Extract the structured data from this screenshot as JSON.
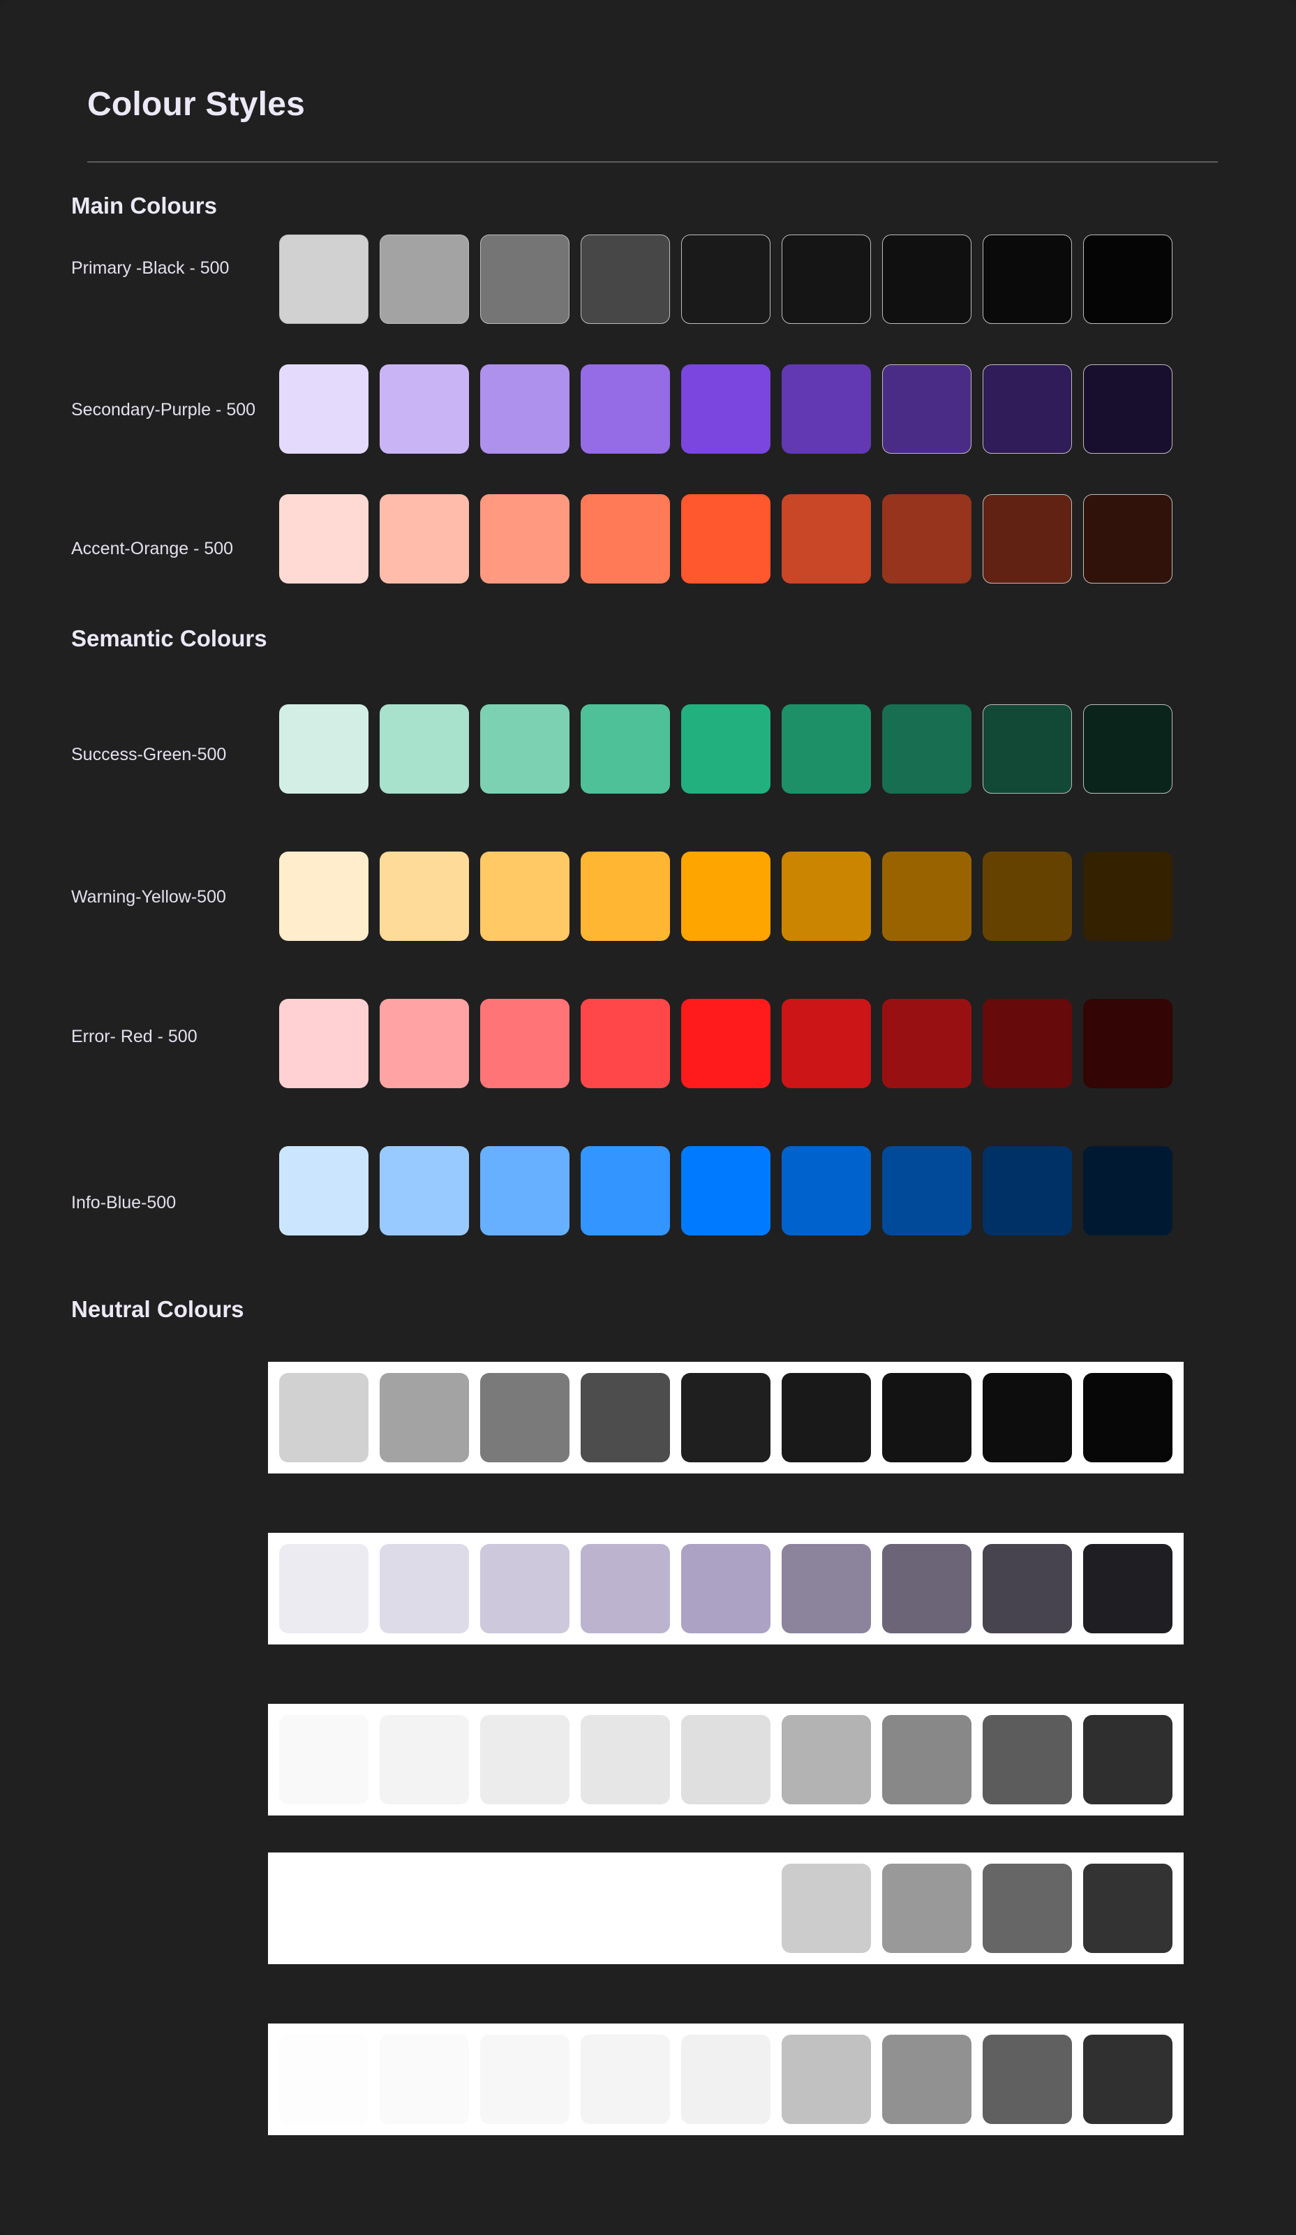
{
  "page": {
    "title": "Colour Styles"
  },
  "sections": {
    "main": "Main Colours",
    "semantic": "Semantic Colours",
    "neutral": "Neutral Colours"
  },
  "palettes": {
    "primary": {
      "label": "Primary -Black - 500",
      "swatches": [
        "#d1d1d1",
        "#a3a3a3",
        "#757575",
        "#474747",
        "#1a1a1a",
        "#151515",
        "#101010",
        "#0a0a0a",
        "#050505"
      ]
    },
    "secondary": {
      "label": "Secondary-Purple - 500",
      "swatches": [
        "#e4dafb",
        "#c9b5f5",
        "#ae90ed",
        "#956be6",
        "#7a46df",
        "#6239b3",
        "#4a2b86",
        "#301c59",
        "#180e2d"
      ]
    },
    "accent": {
      "label": "Accent-Orange - 500",
      "swatches": [
        "#ffdad4",
        "#ffbcab",
        "#ff9a80",
        "#ff7a57",
        "#ff572e",
        "#c94627",
        "#96341e",
        "#622213",
        "#31120b"
      ]
    },
    "success": {
      "label": "Success-Green-500",
      "swatches": [
        "#d3efe5",
        "#a8e1cc",
        "#7dd1b3",
        "#4fc199",
        "#22b07f",
        "#1e9068",
        "#186e50",
        "#124836",
        "#0a241b"
      ]
    },
    "warning": {
      "label": "Warning-Yellow-500",
      "swatches": [
        "#ffedcc",
        "#ffdb99",
        "#ffc966",
        "#ffb733",
        "#ffa500",
        "#cc8500",
        "#996400",
        "#664200",
        "#332100"
      ]
    },
    "error": {
      "label": "Error- Red - 500",
      "swatches": [
        "#ffd1d2",
        "#ffa3a5",
        "#ff7577",
        "#ff4749",
        "#ff1a1c",
        "#cc1517",
        "#991012",
        "#660a0b",
        "#330505"
      ]
    },
    "info": {
      "label": "Info-Blue-500",
      "swatches": [
        "#cce5ff",
        "#99caff",
        "#66b0ff",
        "#3395ff",
        "#007bff",
        "#0062cc",
        "#004a99",
        "#003166",
        "#001933"
      ]
    }
  },
  "neutrals": [
    [
      "#d1d1d1",
      "#a3a3a3",
      "#7a7a7a",
      "#4d4d4d",
      "#1f1f1f",
      "#191919",
      "#131313",
      "#0d0d0d",
      "#070707"
    ],
    [
      "#edebf2",
      "#dedbe8",
      "#cdc8db",
      "#bcb4cf",
      "#aba2c4",
      "#8c849d",
      "#6b6577",
      "#48444f",
      "#1f1e23"
    ],
    [
      "#f9f9f9",
      "#f3f3f3",
      "#ececec",
      "#e6e6e6",
      "#dfdfdf",
      "#b3b3b3",
      "#888888",
      "#5c5c5c",
      "#2f2f2f"
    ],
    [
      "#ffffff",
      "#ffffff",
      "#ffffff",
      "#ffffff",
      "#ffffff",
      "#cccccc",
      "#999999",
      "#666666",
      "#333333"
    ],
    [
      "#fdfdfd",
      "#fafafa",
      "#f7f7f7",
      "#f4f4f4",
      "#f1f1f1",
      "#c1c1c1",
      "#919191",
      "#606060",
      "#303030"
    ]
  ],
  "colors": {
    "background": "#202020",
    "text": "#ece8f6",
    "divider": "#5c5c5c",
    "swatch_outline": "#bdbdbd"
  }
}
